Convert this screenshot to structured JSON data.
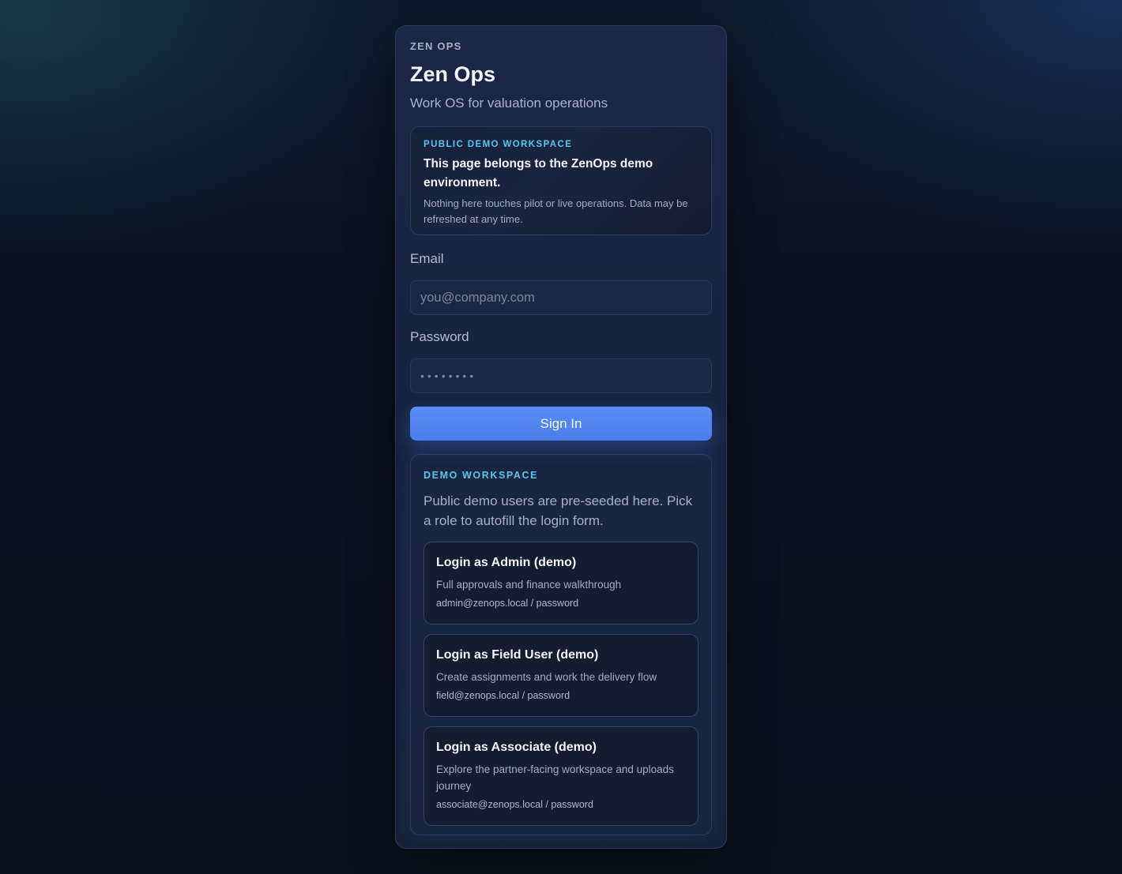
{
  "header": {
    "eyebrow": "ZEN OPS",
    "title": "Zen Ops",
    "subtitle": "Work OS for valuation operations"
  },
  "notice": {
    "kicker": "PUBLIC DEMO WORKSPACE",
    "heading": "This page belongs to the ZenOps demo environment.",
    "body": "Nothing here touches pilot or live operations. Data may be refreshed at any time."
  },
  "form": {
    "email_label": "Email",
    "email_placeholder": "you@company.com",
    "email_value": "",
    "password_label": "Password",
    "password_placeholder": "••••••••",
    "password_value": "",
    "submit_label": "Sign In"
  },
  "demo": {
    "kicker": "DEMO WORKSPACE",
    "description": "Public demo users are pre-seeded here. Pick a role to autofill the login form.",
    "roles": [
      {
        "title": "Login as Admin (demo)",
        "description": "Full approvals and finance walkthrough",
        "credentials": "admin@zenops.local / password"
      },
      {
        "title": "Login as Field User (demo)",
        "description": "Create assignments and work the delivery flow",
        "credentials": "field@zenops.local / password"
      },
      {
        "title": "Login as Associate (demo)",
        "description": "Explore the partner-facing workspace and uploads journey",
        "credentials": "associate@zenops.local / password"
      }
    ]
  },
  "colors": {
    "accent_button": "#4f82ee",
    "kicker_cyan": "#54c7ee",
    "card_bg": "#1b2745",
    "page_bg": "#09111d"
  }
}
